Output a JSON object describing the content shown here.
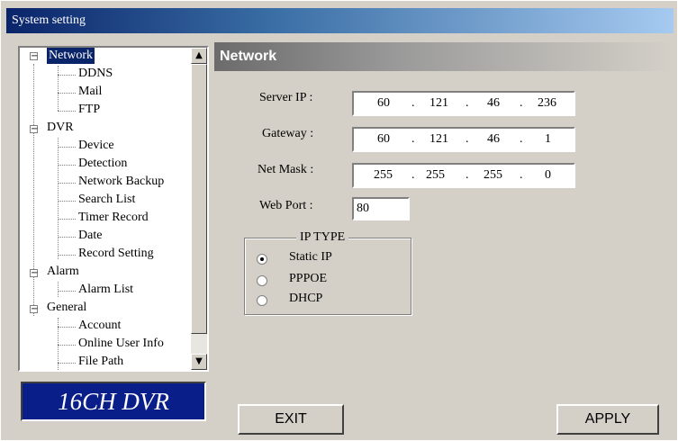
{
  "window": {
    "title": "System setting"
  },
  "tree": {
    "network": "Network",
    "ddns": "DDNS",
    "mail": "Mail",
    "ftp": "FTP",
    "dvr": "DVR",
    "device": "Device",
    "detection": "Detection",
    "network_backup": "Network Backup",
    "search_list": "Search List",
    "timer_record": "Timer Record",
    "date": "Date",
    "record_setting": "Record Setting",
    "alarm": "Alarm",
    "alarm_list": "Alarm List",
    "general": "General",
    "account": "Account",
    "online_user_info": "Online User Info",
    "file_path": "File Path",
    "expand_symbol": "−"
  },
  "panel": {
    "title": "Network",
    "server_ip_label": "Server IP :",
    "server_ip": [
      "60",
      "121",
      "46",
      "236"
    ],
    "gateway_label": "Gateway :",
    "gateway": [
      "60",
      "121",
      "46",
      "1"
    ],
    "netmask_label": "Net Mask :",
    "netmask": [
      "255",
      "255",
      "255",
      "0"
    ],
    "web_port_label": "Web Port :",
    "web_port": "80",
    "ip_type_label": "IP TYPE",
    "ip_type_options": [
      "Static IP",
      "PPPOE",
      "DHCP"
    ],
    "ip_type_selected": "Static IP",
    "dot": "."
  },
  "logo": {
    "text": "16CH DVR"
  },
  "buttons": {
    "exit": "EXIT",
    "apply": "APPLY"
  },
  "scroll": {
    "up": "▲",
    "down": "▼"
  }
}
